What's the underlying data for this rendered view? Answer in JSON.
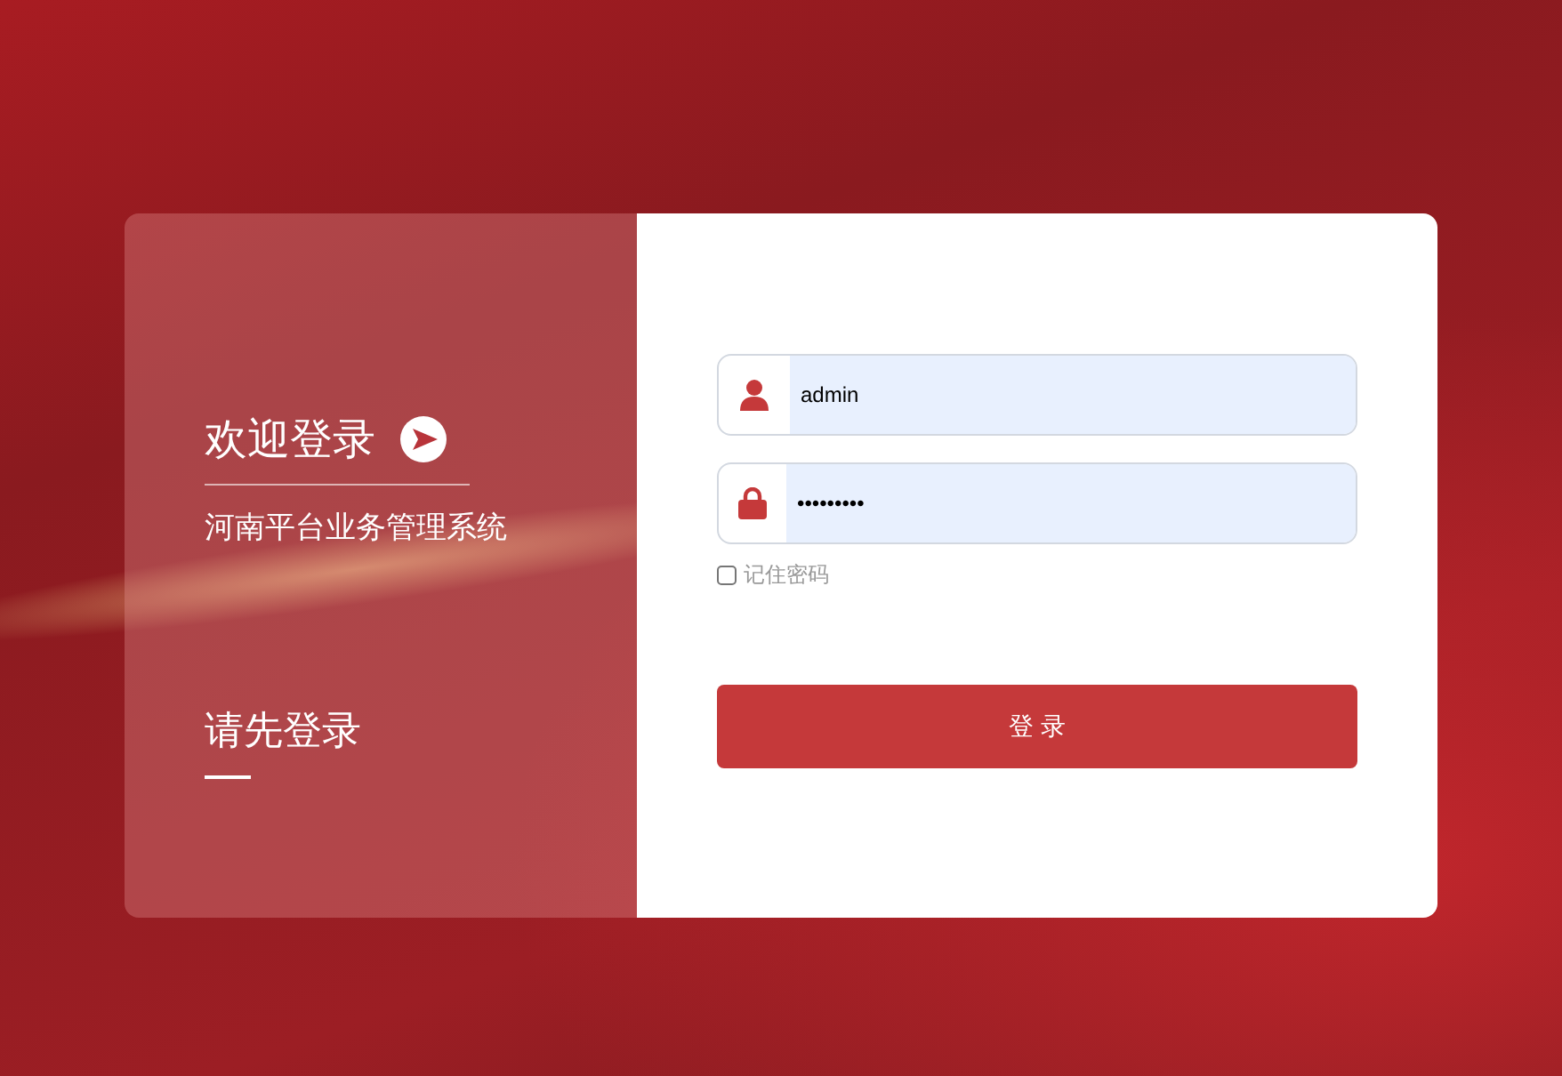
{
  "welcome": {
    "title": "欢迎登录",
    "subtitle": "河南平台业务管理系统",
    "prompt": "请先登录"
  },
  "form": {
    "username": {
      "value": "admin"
    },
    "password": {
      "value": "•••••••••"
    },
    "remember": {
      "label": "记住密码",
      "checked": false
    },
    "submit": "登 录"
  }
}
